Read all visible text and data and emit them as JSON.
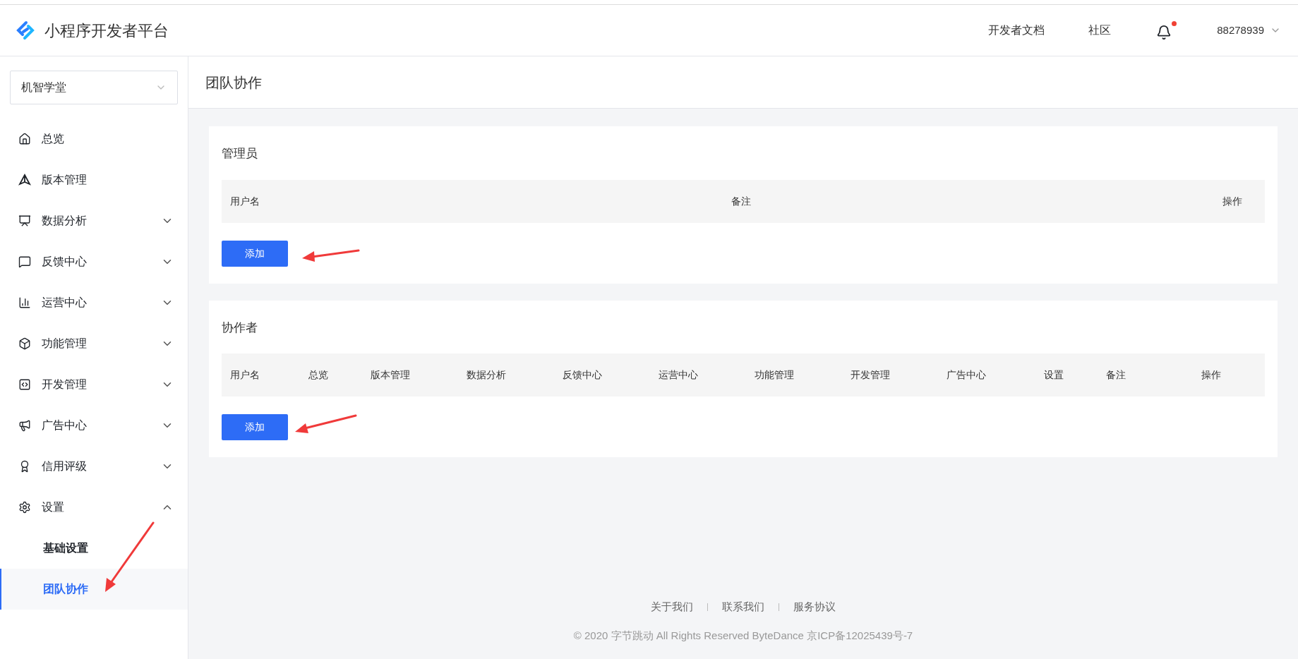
{
  "header": {
    "logo_text": "小程序开发者平台",
    "links": [
      "开发者文档",
      "社区"
    ],
    "notification_dot": true,
    "account": "88278939"
  },
  "sidebar": {
    "app_select": "机智学堂",
    "items": [
      {
        "kind": "home",
        "label": "总览"
      },
      {
        "kind": "version",
        "label": "版本管理"
      },
      {
        "kind": "analytics",
        "label": "数据分析",
        "expanded": false
      },
      {
        "kind": "feedback",
        "label": "反馈中心",
        "expanded": false
      },
      {
        "kind": "operations",
        "label": "运营中心",
        "expanded": false
      },
      {
        "kind": "features",
        "label": "功能管理",
        "expanded": false
      },
      {
        "kind": "dev",
        "label": "开发管理",
        "expanded": false
      },
      {
        "kind": "ads",
        "label": "广告中心",
        "expanded": false
      },
      {
        "kind": "credit",
        "label": "信用评级",
        "expanded": false
      },
      {
        "kind": "settings",
        "label": "设置",
        "expanded": true,
        "children": [
          {
            "label": "基础设置",
            "selected": false
          },
          {
            "label": "团队协作",
            "selected": true
          }
        ]
      }
    ]
  },
  "page_title": "团队协作",
  "sections": [
    {
      "title": "管理员",
      "kind": "spread",
      "columns": [
        "用户名",
        "备注",
        "操作"
      ],
      "button": "添加"
    },
    {
      "title": "协作者",
      "kind": "grid",
      "columns": [
        "用户名",
        "总览",
        "版本管理",
        "数据分析",
        "反馈中心",
        "运营中心",
        "功能管理",
        "开发管理",
        "广告中心",
        "设置",
        "备注",
        "操作"
      ],
      "button": "添加"
    }
  ],
  "footer": {
    "links": [
      "关于我们",
      "联系我们",
      "服务协议"
    ],
    "copyright": "© 2020 字节跳动 All Rights Reserved ByteDance 京ICP备12025439号-7"
  }
}
